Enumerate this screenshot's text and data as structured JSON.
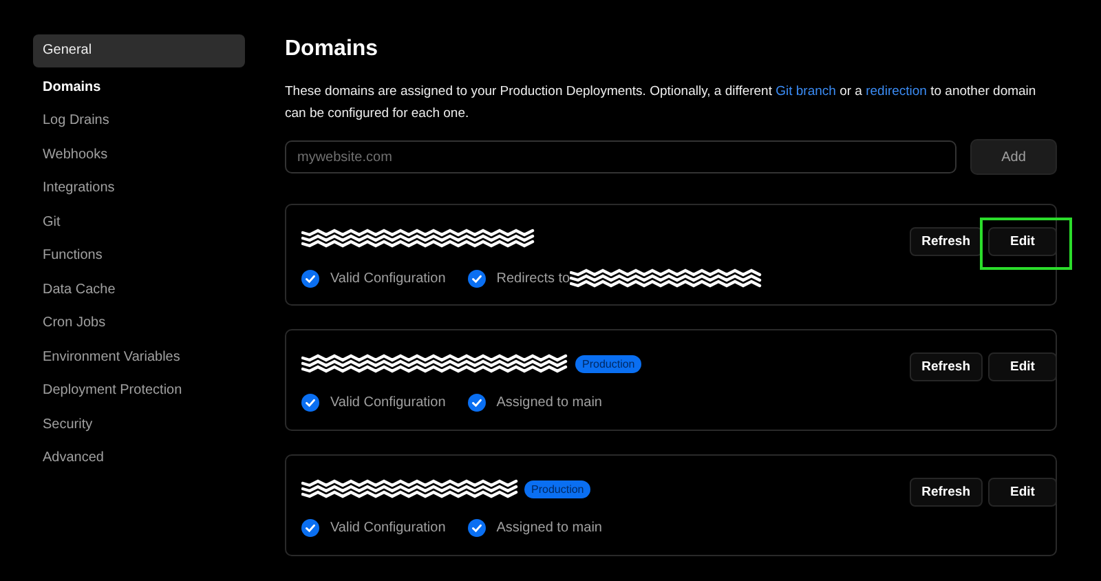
{
  "sidebar": {
    "items": [
      {
        "label": "General",
        "selected": true,
        "current": false
      },
      {
        "label": "Domains",
        "selected": false,
        "current": true
      },
      {
        "label": "Log Drains",
        "selected": false,
        "current": false
      },
      {
        "label": "Webhooks",
        "selected": false,
        "current": false
      },
      {
        "label": "Integrations",
        "selected": false,
        "current": false
      },
      {
        "label": "Git",
        "selected": false,
        "current": false
      },
      {
        "label": "Functions",
        "selected": false,
        "current": false
      },
      {
        "label": "Data Cache",
        "selected": false,
        "current": false
      },
      {
        "label": "Cron Jobs",
        "selected": false,
        "current": false
      },
      {
        "label": "Environment Variables",
        "selected": false,
        "current": false
      },
      {
        "label": "Deployment Protection",
        "selected": false,
        "current": false
      },
      {
        "label": "Security",
        "selected": false,
        "current": false
      },
      {
        "label": "Advanced",
        "selected": false,
        "current": false
      }
    ]
  },
  "page": {
    "title": "Domains",
    "description": [
      {
        "kind": "text",
        "text": "These domains are assigned to your Production Deployments. Optionally, a different "
      },
      {
        "kind": "link",
        "text": "Git branch"
      },
      {
        "kind": "text",
        "text": " or a "
      },
      {
        "kind": "link",
        "text": "redirection"
      },
      {
        "kind": "text",
        "text": " to another domain can be configured for each one."
      }
    ],
    "domain_field": {
      "placeholder": "mywebsite.com"
    },
    "add_button": "Add",
    "domains": [
      {
        "statuses": [
          {
            "kind": "text",
            "text": "Valid Configuration"
          },
          {
            "kind": "redirect",
            "text": "Redirects to"
          }
        ],
        "buttons": [
          {
            "label": "Refresh",
            "highlighted": false
          },
          {
            "label": "Edit",
            "highlighted": true
          }
        ]
      },
      {
        "badge": "Production",
        "statuses": [
          {
            "kind": "text",
            "text": "Valid Configuration"
          },
          {
            "kind": "text",
            "text": "Assigned to main"
          }
        ],
        "buttons": [
          {
            "label": "Refresh",
            "highlighted": false
          },
          {
            "label": "Edit",
            "highlighted": false
          }
        ]
      },
      {
        "badge": "Production",
        "statuses": [
          {
            "kind": "text",
            "text": "Valid Configuration"
          },
          {
            "kind": "text",
            "text": "Assigned to main"
          }
        ],
        "buttons": [
          {
            "label": "Refresh",
            "highlighted": false
          },
          {
            "label": "Edit",
            "highlighted": false
          }
        ]
      }
    ]
  }
}
